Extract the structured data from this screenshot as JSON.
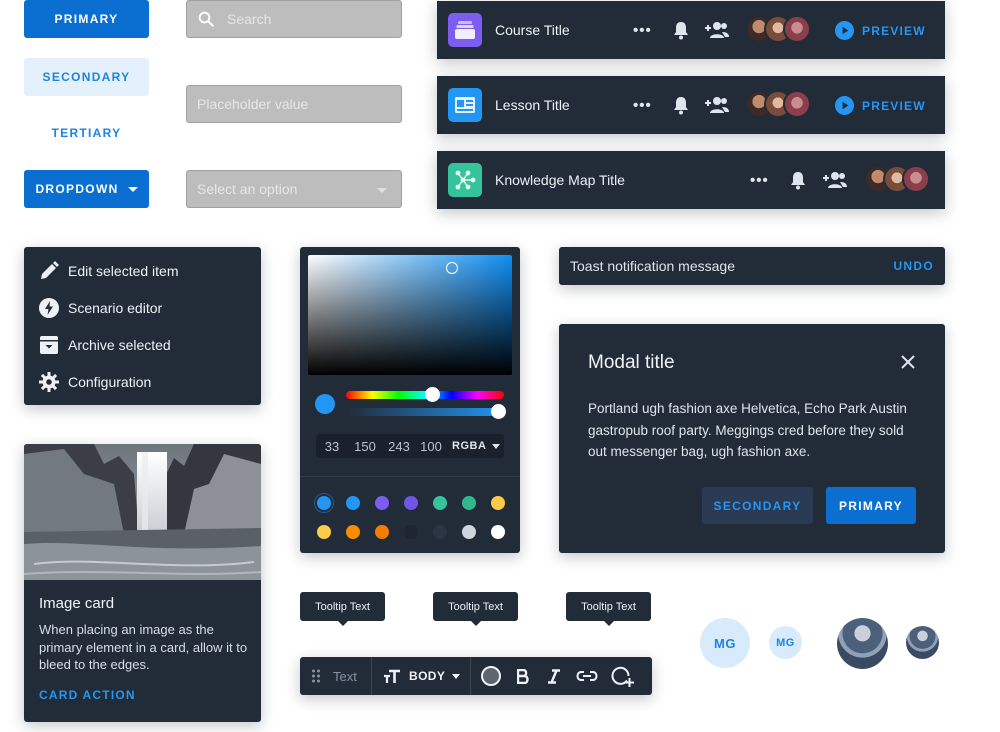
{
  "buttons": {
    "primary": "PRIMARY",
    "secondary": "SECONDARY",
    "tertiary": "TERTIARY",
    "dropdown": "DROPDOWN"
  },
  "inputs": {
    "search_placeholder": "Search",
    "value_placeholder": "Placeholder value",
    "select_placeholder": "Select an option"
  },
  "title_bars": [
    {
      "title": "Course Title",
      "icon": "course-icon",
      "color": "#7c5cf1",
      "preview": "PREVIEW"
    },
    {
      "title": "Lesson Title",
      "icon": "lesson-icon",
      "color": "#2196f3",
      "preview": "PREVIEW"
    },
    {
      "title": "Knowledge Map Title",
      "icon": "knowledge-map-icon",
      "color": "#35c39b"
    }
  ],
  "menu": {
    "items": [
      {
        "label": "Edit selected item",
        "icon": "pencil-icon"
      },
      {
        "label": "Scenario editor",
        "icon": "bolt-icon"
      },
      {
        "label": "Archive selected",
        "icon": "archive-icon"
      },
      {
        "label": "Configuration",
        "icon": "gear-icon"
      }
    ]
  },
  "color_picker": {
    "r": "33",
    "g": "150",
    "b": "243",
    "a": "100",
    "mode": "RGBA",
    "selected_color": "#2196f3",
    "hue_level": 0.55,
    "alpha_level": 1.0,
    "swatches": [
      "#2196f3",
      "#2196f3",
      "#7c5cf1",
      "#6f55e8",
      "#35c39b",
      "#33b78f",
      "#ffc94a",
      "#ffc94a",
      "#fb8c00",
      "#f57c00",
      "#1d2533",
      "#2b3546",
      "#d0d4db",
      "#ffffff"
    ]
  },
  "image_card": {
    "title": "Image card",
    "body": "When placing an image as the primary element in a card, allow it to bleed to the edges.",
    "action": "CARD ACTION"
  },
  "toast": {
    "message": "Toast notification message",
    "action": "UNDO"
  },
  "modal": {
    "title": "Modal title",
    "body": "Portland ugh fashion axe Helvetica, Echo Park Austin gastropub roof party. Meggings cred before they sold out messenger bag, ugh fashion axe.",
    "secondary": "SECONDARY",
    "primary": "PRIMARY"
  },
  "tooltips": [
    "Tooltip Text",
    "Tooltip Text",
    "Tooltip Text"
  ],
  "toolbar": {
    "text_label": "Text",
    "style_label": "BODY"
  },
  "avatars": {
    "large_initials": "MG",
    "small_initials": "MG"
  },
  "colors": {
    "accent": "#0a6fd1",
    "panel": "#222b38"
  }
}
